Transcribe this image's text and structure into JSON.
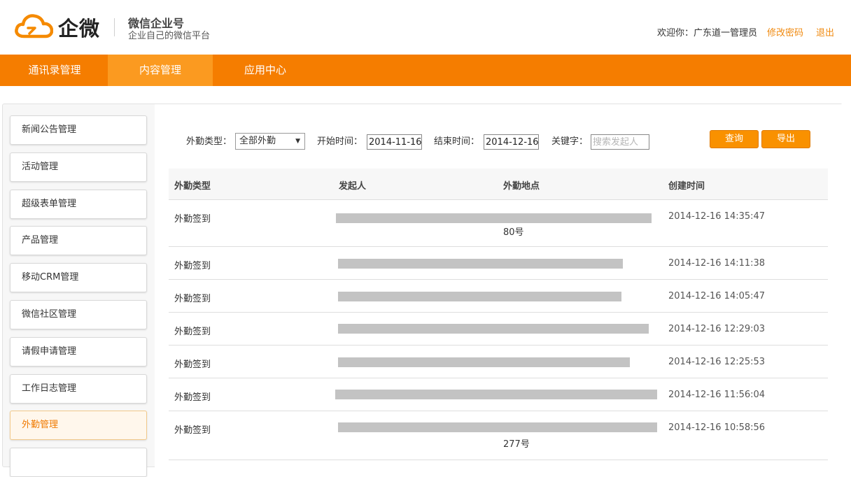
{
  "header": {
    "brand": "企微",
    "title": "微信企业号",
    "subtitle": "企业自己的微信平台",
    "welcome": "欢迎你：广东道一管理员",
    "change_password": "修改密码",
    "logout": "退出"
  },
  "topnav": {
    "tabs": [
      {
        "label": "通讯录管理"
      },
      {
        "label": "内容管理"
      },
      {
        "label": "应用中心"
      }
    ],
    "active_index": 1
  },
  "sidebar": {
    "items": [
      {
        "label": "新闻公告管理"
      },
      {
        "label": "活动管理"
      },
      {
        "label": "超级表单管理"
      },
      {
        "label": "产品管理"
      },
      {
        "label": "移动CRM管理"
      },
      {
        "label": "微信社区管理"
      },
      {
        "label": "请假申请管理"
      },
      {
        "label": "工作日志管理"
      },
      {
        "label": "外勤管理"
      }
    ],
    "active_label": "外勤管理"
  },
  "filters": {
    "type_label": "外勤类型：",
    "type_value": "全部外勤",
    "start_label": "开始时间：",
    "start_value": "2014-11-16",
    "end_label": "结束时间：",
    "end_value": "2014-12-16",
    "keyword_label": "关键字：",
    "keyword_placeholder": "搜索发起人",
    "query_button": "查询",
    "export_button": "导出"
  },
  "table": {
    "columns": [
      "外勤类型",
      "发起人",
      "外勤地点",
      "创建时间"
    ],
    "rows": [
      {
        "type": "外勤签到",
        "location_tail": "80号",
        "time": "2014-12-16 14:35:47"
      },
      {
        "type": "外勤签到",
        "location_tail": "",
        "time": "2014-12-16 14:11:38"
      },
      {
        "type": "外勤签到",
        "location_tail": "",
        "time": "2014-12-16 14:05:47"
      },
      {
        "type": "外勤签到",
        "location_tail": "",
        "time": "2014-12-16 12:29:03"
      },
      {
        "type": "外勤签到",
        "location_tail": "",
        "time": "2014-12-16 12:25:53"
      },
      {
        "type": "外勤签到",
        "location_tail": "",
        "time": "2014-12-16 11:56:04"
      },
      {
        "type": "外勤签到",
        "location_tail": "277号",
        "time": "2014-12-16 10:58:56"
      }
    ]
  },
  "colors": {
    "accent": "#f57d00",
    "accent_active": "#fb9a20",
    "button": "#f99100",
    "link": "#f08a10"
  }
}
